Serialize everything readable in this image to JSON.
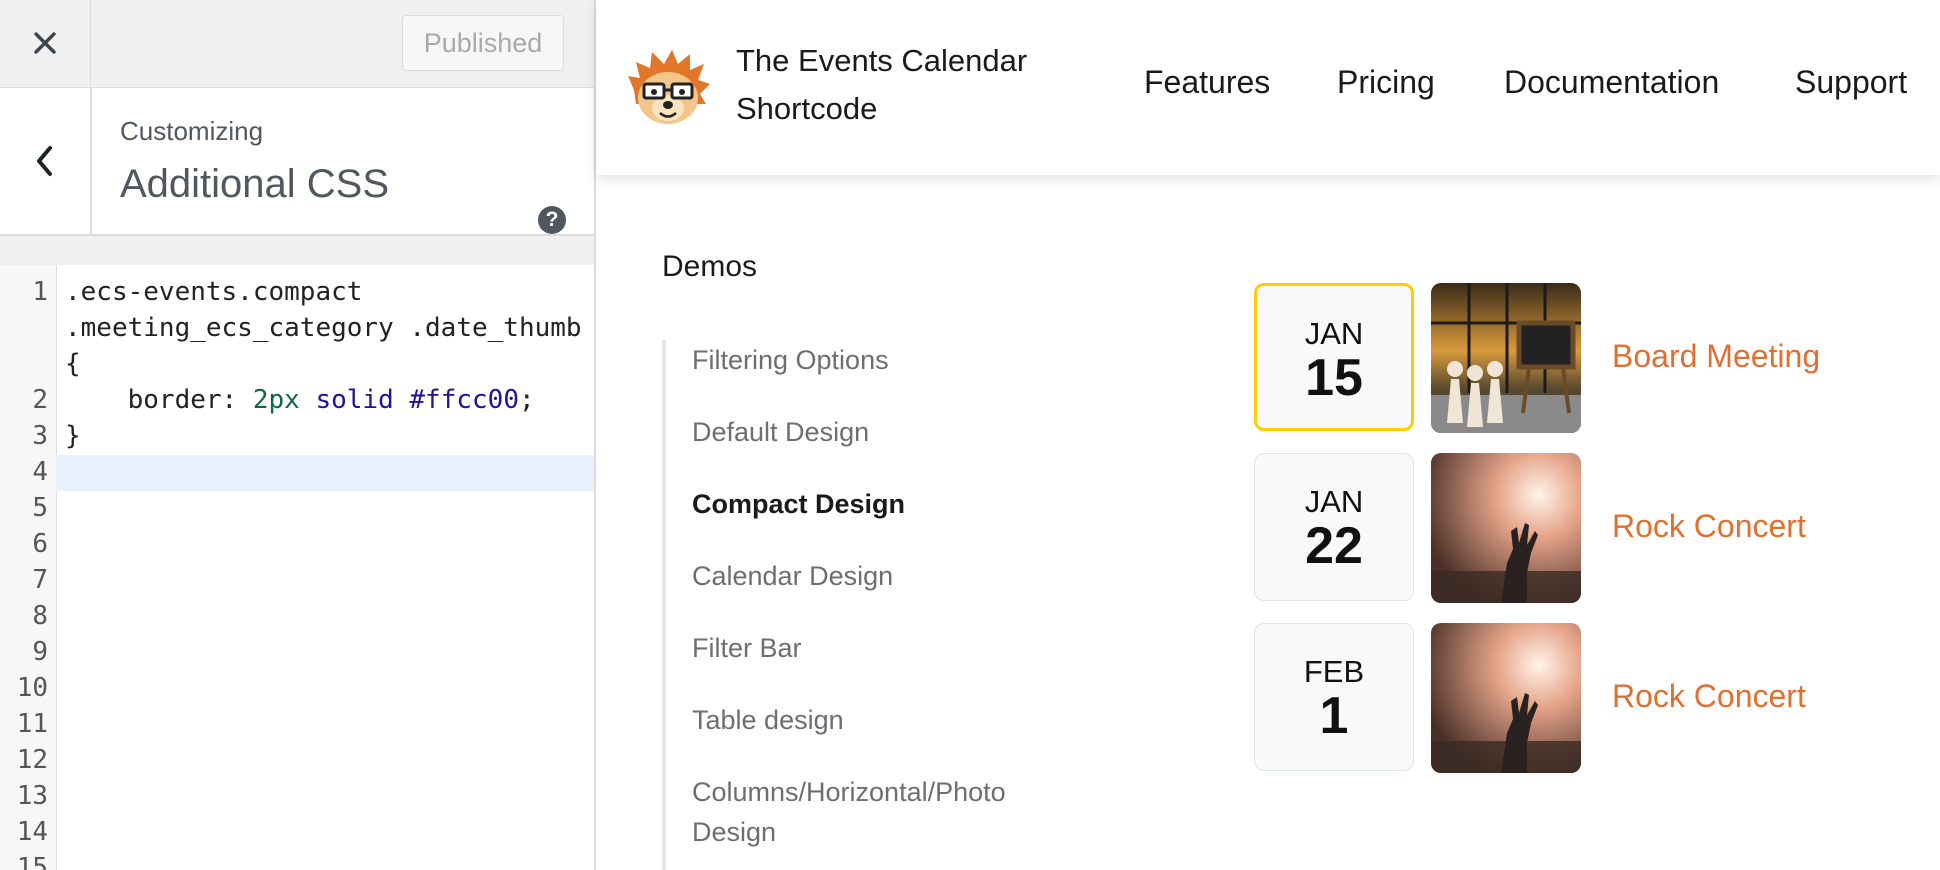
{
  "customizer": {
    "close_icon": "close-icon",
    "publish_label": "Published",
    "back_icon": "chevron-left-icon",
    "customizing_label": "Customizing",
    "section_title": "Additional CSS",
    "help_icon": "question-icon",
    "help_glyph": "?"
  },
  "editor": {
    "line_numbers": [
      "1",
      "2",
      "3",
      "4",
      "5",
      "6",
      "7",
      "8",
      "9",
      "10",
      "11",
      "12",
      "13",
      "14",
      "15"
    ],
    "code": {
      "l1a": ".ecs-events.compact",
      "l1b": ".meeting_ecs_category .date_thumb",
      "l1c": "{",
      "l2_prop": "    border: ",
      "l2_num": "2px",
      "l2_kw": "solid",
      "l2_hex": "#ffcc00",
      "l2_end": ";",
      "l3": "}"
    }
  },
  "site": {
    "logo_icon": "hedgehog-logo-icon",
    "title_line1": "The Events Calendar",
    "title_line2": "Shortcode",
    "nav": [
      "Features",
      "Pricing",
      "Documentation",
      "Support"
    ]
  },
  "demos": {
    "title": "Demos",
    "items": [
      "Filtering Options",
      "Default Design",
      "Compact Design",
      "Calendar Design",
      "Filter Bar",
      "Table design",
      "Columns/Horizontal/Photo Design"
    ],
    "active_index": 2
  },
  "events": [
    {
      "month": "JAN",
      "day": "15",
      "title": "Board Meeting",
      "image": "board-meeting-photo"
    },
    {
      "month": "JAN",
      "day": "22",
      "title": "Rock Concert",
      "image": "concert-photo"
    },
    {
      "month": "FEB",
      "day": "1",
      "title": "Rock Concert",
      "image": "concert-photo"
    }
  ],
  "colors": {
    "event_link": "#e07030",
    "highlight_border": "#ffcc00"
  }
}
